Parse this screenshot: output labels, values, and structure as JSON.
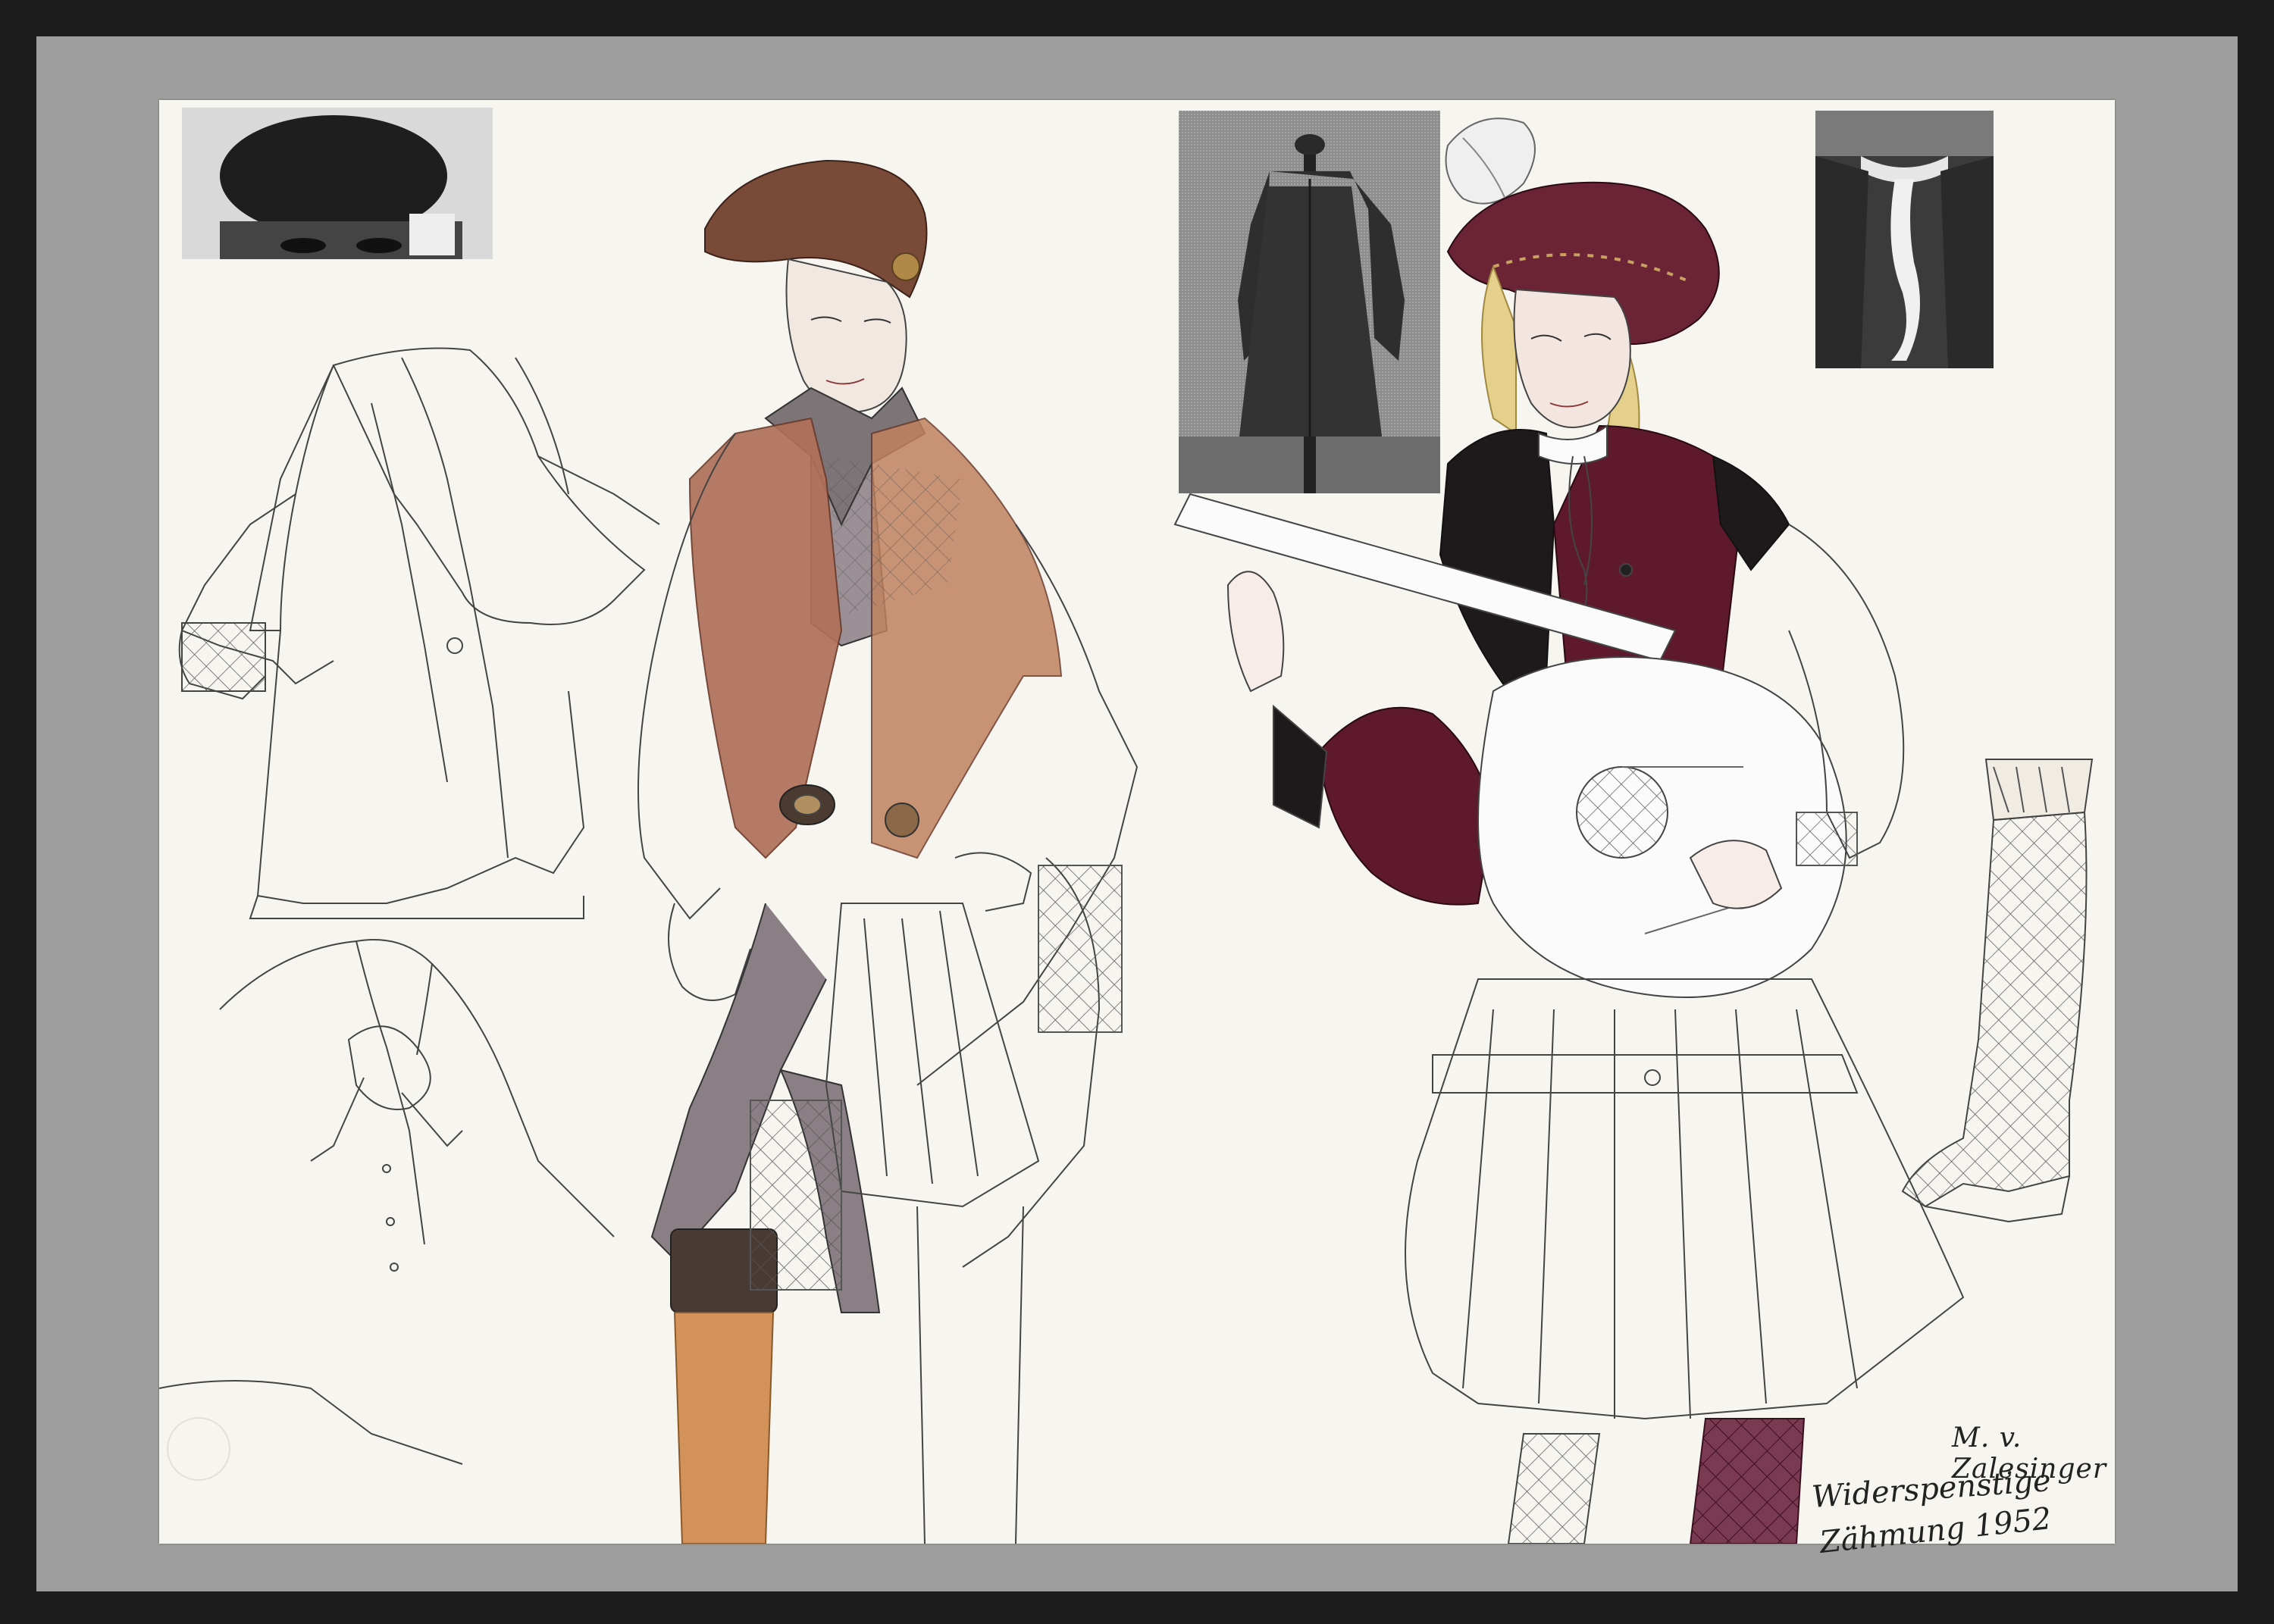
{
  "artwork": {
    "signature": "M. v. Zalesinger",
    "caption_line1": "Widerspenstige",
    "caption_line2": "Zähmung 1952"
  },
  "colors": {
    "mount": "#9e9e9e",
    "paper": "#f7f5f0",
    "cap_brown": "#7a4a38",
    "doublet_rust": "#b0705a",
    "hat_plum": "#6a2436",
    "vest_plum": "#5e1a2c",
    "hose_grey": "#8a7f84",
    "boot_ochre": "#d2925a"
  },
  "reference_photos": [
    {
      "name": "beret-photo"
    },
    {
      "name": "coat-on-mannequin-photo"
    },
    {
      "name": "neckerchief-photo"
    }
  ]
}
